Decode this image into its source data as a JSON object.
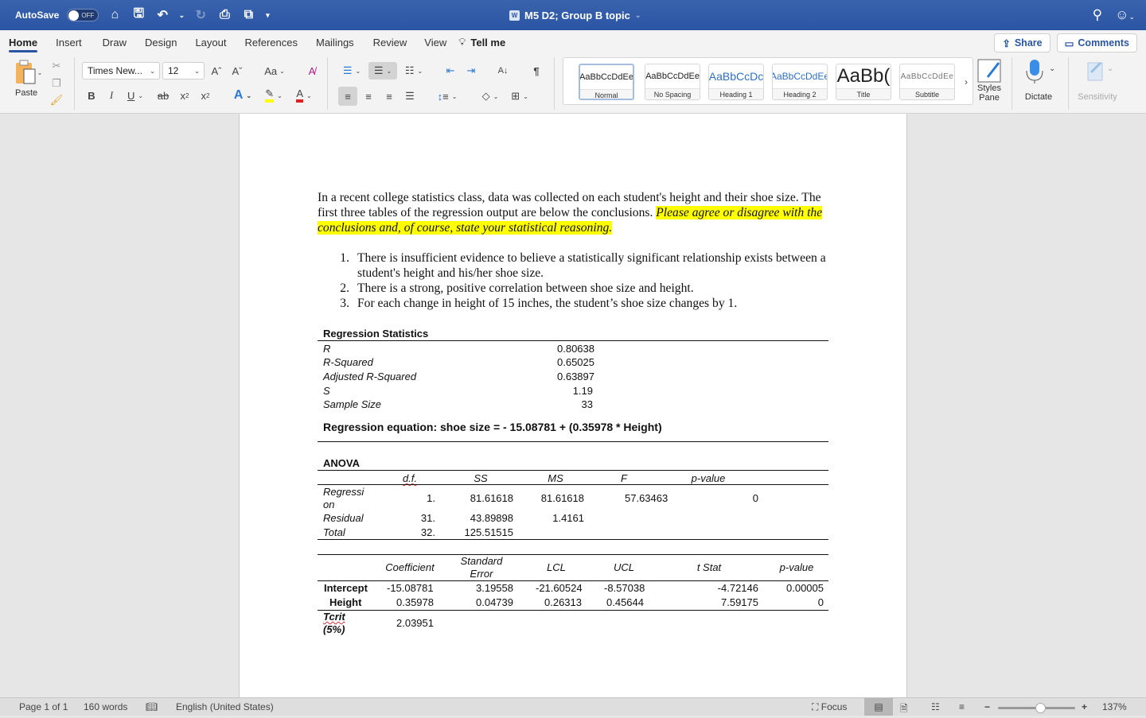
{
  "titlebar": {
    "autosave_label": "AutoSave",
    "autosave_state": "OFF",
    "doc_title": "M5 D2; Group B topic",
    "icons": [
      "home-icon",
      "save-icon",
      "undo-icon",
      "redo-icon",
      "print-icon",
      "customize-icon",
      "more-icon"
    ]
  },
  "menu": {
    "tabs": [
      "Home",
      "Insert",
      "Draw",
      "Design",
      "Layout",
      "References",
      "Mailings",
      "Review",
      "View"
    ],
    "active_tab": "Home",
    "tell_me": "Tell me",
    "share": "Share",
    "comments": "Comments"
  },
  "ribbon": {
    "paste": "Paste",
    "font_name": "Times New...",
    "font_size": "12",
    "change_case": "Aa",
    "styles": [
      {
        "sample": "AaBbCcDdEe",
        "name": "Normal"
      },
      {
        "sample": "AaBbCcDdEe",
        "name": "No Spacing"
      },
      {
        "sample": "AaBbCcDc",
        "name": "Heading 1"
      },
      {
        "sample": "AaBbCcDdEe",
        "name": "Heading 2"
      },
      {
        "sample": "AaBb(",
        "name": "Title"
      },
      {
        "sample": "AaBbCcDdEe",
        "name": "Subtitle"
      }
    ],
    "styles_pane": "Styles Pane",
    "dictate": "Dictate",
    "sensitivity": "Sensitivity",
    "colors": {
      "highlight": "#ffff00",
      "font_color": "#e02020",
      "accent": "#2b55a3"
    }
  },
  "document": {
    "intro_plain": "In a recent college statistics class, data was collected on each student's height and their shoe size.  The first three tables of the regression output are below the conclusions.  ",
    "intro_highlight": "Please agree or disagree with the conclusions and, of course, state your statistical reasoning.",
    "conclusions": [
      {
        "num": "1.",
        "text": "There is insufficient evidence to believe a statistically significant relationship exists between a student's height and his/her shoe size."
      },
      {
        "num": "2.",
        "text": "There is a strong, positive correlation between shoe size and height."
      },
      {
        "num": "3.",
        "text": "For each change in height of 15 inches, the student’s shoe size changes by 1."
      }
    ],
    "regression_statistics": {
      "title": "Regression Statistics",
      "rows": [
        {
          "label": "R",
          "value": "0.80638"
        },
        {
          "label": "R-Squared",
          "value": "0.65025"
        },
        {
          "label": "Adjusted R-Squared",
          "value": "0.63897"
        },
        {
          "label": "S",
          "value": "1.19"
        },
        {
          "label": "Sample Size",
          "value": "33"
        }
      ],
      "equation": "Regression equation:  shoe size = - 15.08781 + (0.35978 * Height)"
    },
    "anova": {
      "title": "ANOVA",
      "headers": [
        "d.f.",
        "SS",
        "MS",
        "F",
        "p-value"
      ],
      "rows": [
        {
          "label": "Regressi on",
          "df": "1.",
          "ss": "81.61618",
          "ms": "81.61618",
          "f": "57.63463",
          "p": "0"
        },
        {
          "label": "Residual",
          "df": "31.",
          "ss": "43.89898",
          "ms": "1.4161",
          "f": "",
          "p": ""
        },
        {
          "label": "Total",
          "df": "32.",
          "ss": "125.51515",
          "ms": "",
          "f": "",
          "p": ""
        }
      ]
    },
    "coefficients": {
      "headers": [
        "Coefficient",
        "Standard Error",
        "LCL",
        "UCL",
        "t Stat",
        "p-value"
      ],
      "rows": [
        {
          "label": "Intercept",
          "coef": "-15.08781",
          "se": "3.19558",
          "lcl": "-21.60524",
          "ucl": "-8.57038",
          "t": "-4.72146",
          "p": "0.00005"
        },
        {
          "label": "Height",
          "coef": "0.35978",
          "se": "0.04739",
          "lcl": "0.26313",
          "ucl": "0.45644",
          "t": "7.59175",
          "p": "0"
        }
      ],
      "tcrit_label": "Tcrit",
      "tcrit_sub": "(5%)",
      "tcrit_value": "2.03951"
    }
  },
  "statusbar": {
    "page": "Page 1 of 1",
    "words": "160 words",
    "language": "English (United States)",
    "focus": "Focus",
    "zoom": "137%",
    "zoom_level_fraction": 0.55
  }
}
